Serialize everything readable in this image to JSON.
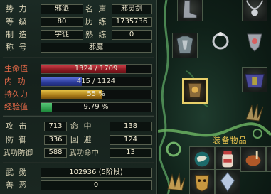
{
  "profile": {
    "faction_label": "势 力",
    "faction_value": "邪派",
    "fame_label": "名 声",
    "fame_value": "邪灵剑",
    "level_label": "等 级",
    "level_value": "80",
    "history_label": "历 练",
    "history_value": "1735736",
    "craft_label": "制 造",
    "craft_value": "学徒",
    "skill_label": "熟 练",
    "skill_value": "0",
    "title_label": "称 号",
    "title_value": "邪魔"
  },
  "bars": {
    "hp": {
      "label": "生命值",
      "text": "1324 / 1709",
      "current": 1324,
      "max": 1709
    },
    "mp": {
      "label": "内 功",
      "text": "415 / 1124",
      "current": 415,
      "max": 1124
    },
    "stamina": {
      "label": "持久力",
      "text": "55 %",
      "percent": 55
    },
    "exp": {
      "label": "经验值",
      "text": "9.79 %",
      "percent": 9.79
    }
  },
  "combat": {
    "attack_label": "攻 击",
    "attack_value": "713",
    "hit_label": "命 中",
    "hit_value": "138",
    "defense_label": "防 御",
    "defense_value": "336",
    "evade_label": "回 避",
    "evade_value": "124",
    "martial_def_label": "武功防御",
    "martial_def_value": "588",
    "martial_hit_label": "武功命中",
    "martial_hit_value": "13"
  },
  "merit": {
    "wuxun_label": "武 勋",
    "wuxun_value": "102936 (5阶段)",
    "karma_label": "善 恶",
    "karma_value": "0"
  },
  "equipment": {
    "header": "装备物品",
    "slots": [
      {
        "icon": "boots-icon"
      },
      {
        "icon": "necklace-icon"
      },
      {
        "icon": "ring-icon"
      },
      {
        "icon": "amulet-icon"
      },
      {
        "icon": "armor-icon",
        "selected": true
      },
      {
        "icon": "chest-armor-icon"
      },
      {
        "icon": "weapon-claw-icon"
      },
      {
        "icon": "gauntlet-icon",
        "selected": true
      }
    ],
    "inventory": [
      {
        "icon": "earth-orb-icon"
      },
      {
        "icon": "medicine-jar-icon"
      },
      {
        "icon": "roasted-meat-icon"
      },
      {
        "icon": "flame-shard-icon"
      },
      {
        "icon": "claw-icon"
      },
      {
        "icon": "golden-mask-icon"
      },
      {
        "icon": "crystal-icon"
      }
    ]
  },
  "colors": {
    "hp": "#b02a34",
    "mp": "#3a4ab8",
    "stamina": "#d4a82e",
    "exp": "#2fa04e",
    "label_red": "#e06848",
    "gold": "#f0c850"
  }
}
